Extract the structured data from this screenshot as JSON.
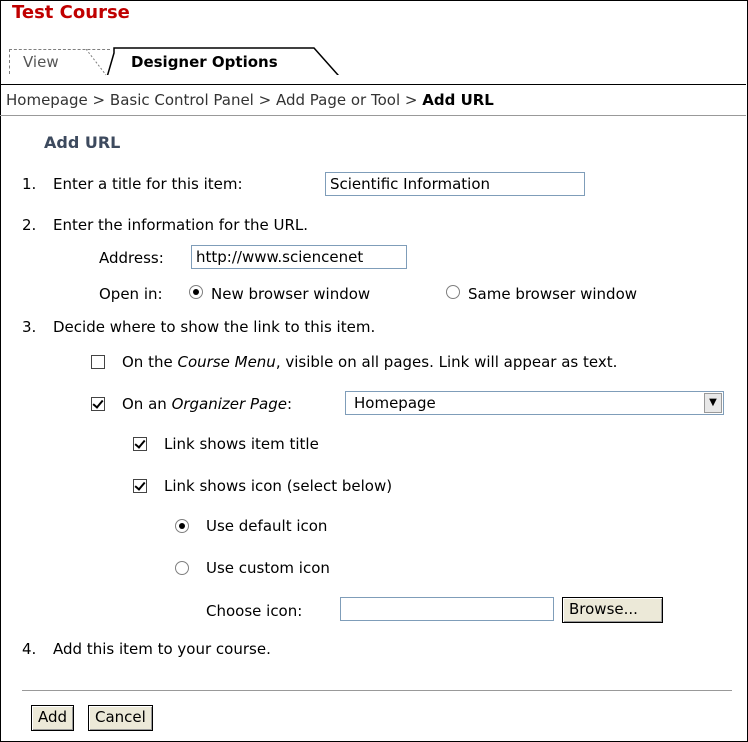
{
  "course": {
    "title": "Test Course"
  },
  "tabs": [
    {
      "label": "View"
    },
    {
      "label": "Designer Options"
    }
  ],
  "breadcrumb": {
    "items": [
      "Homepage",
      "Basic Control Panel",
      "Add Page or Tool"
    ],
    "separator": ">",
    "current": "Add URL"
  },
  "form": {
    "title": "Add URL",
    "step1": {
      "number": "1.",
      "label": "Enter a title for this item:",
      "value": "Scientific Information"
    },
    "step2": {
      "number": "2.",
      "label": "Enter the information for the URL.",
      "address_label": "Address:",
      "address_value": "http://www.sciencenet",
      "open_in_label": "Open in:",
      "new_window": "New browser window",
      "same_window": "Same browser window"
    },
    "step3": {
      "number": "3.",
      "label": "Decide where to show the link to this item.",
      "course_menu_pre": "On the",
      "course_menu_em": "Course Menu",
      "course_menu_post": ", visible on all pages. Link will appear as text.",
      "organizer_pre": "On an",
      "organizer_em": "Organizer Page",
      "organizer_post": ":",
      "organizer_selected": "Homepage",
      "link_title": "Link shows item title",
      "link_icon": "Link shows icon (select below)",
      "default_icon": "Use default icon",
      "custom_icon": "Use custom icon",
      "choose_icon_label": "Choose icon:",
      "browse_label": "Browse..."
    },
    "step4": {
      "number": "4.",
      "label": "Add this item to your course."
    }
  },
  "buttons": {
    "add": "Add",
    "cancel": "Cancel"
  }
}
